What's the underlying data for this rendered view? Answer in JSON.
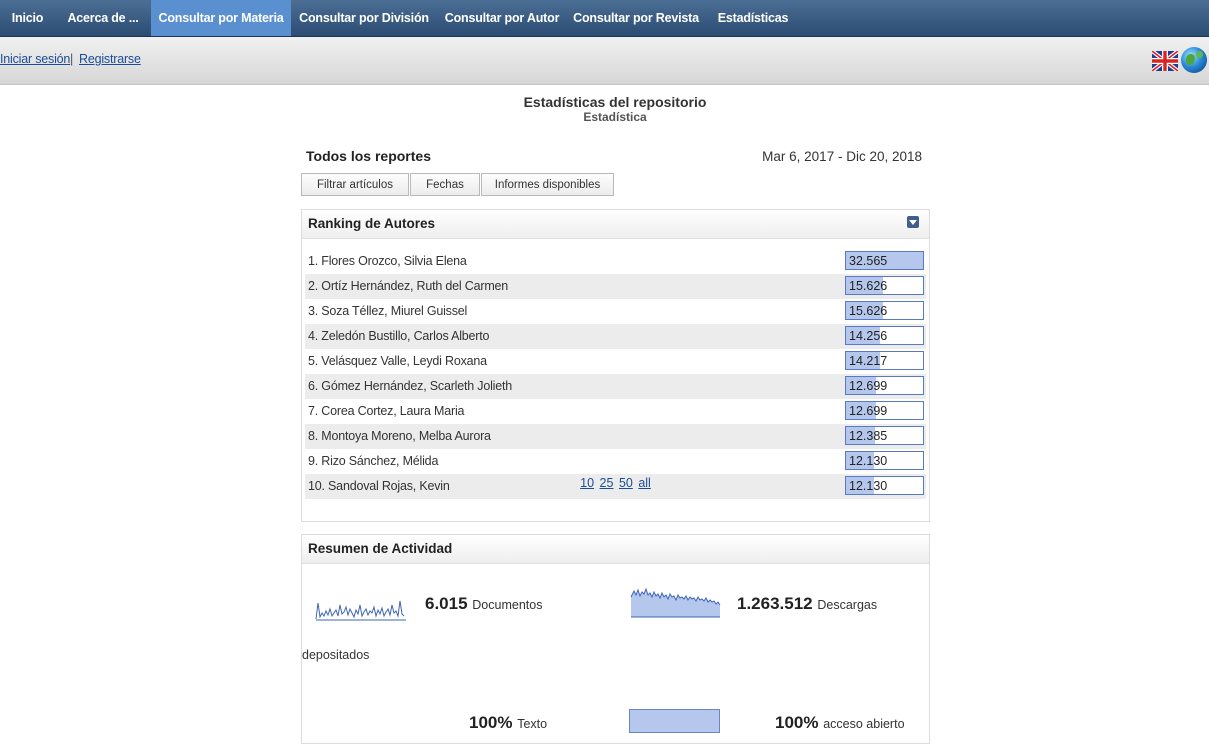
{
  "nav": {
    "items": [
      {
        "label": "Inicio"
      },
      {
        "label": "Acerca de ..."
      },
      {
        "label": "Consultar por Materia"
      },
      {
        "label": "Consultar por División"
      },
      {
        "label": "Consultar por Autor"
      },
      {
        "label": "Consultar por Revista"
      },
      {
        "label": "Estadísticas"
      }
    ],
    "active": "Consultar por Materia"
  },
  "login": {
    "login_label": "Iniciar sesión",
    "separator": "|",
    "register_label": "Registrarse"
  },
  "header": {
    "title": "Estadísticas del repositorio",
    "subtitle": "Estadística"
  },
  "reports": {
    "title": "Todos los reportes",
    "date_range": "Mar 6, 2017 - Dic 20, 2018",
    "buttons": [
      "Filtrar artículos",
      "Fechas",
      "Informes disponibles"
    ]
  },
  "ranking": {
    "title": "Ranking de Autores",
    "items": [
      {
        "label": "1. Flores Orozco, Silvia Elena",
        "value": "32.565",
        "fraction": 1.0
      },
      {
        "label": "2. Ortíz Hernández, Ruth del Carmen",
        "value": "15.626",
        "fraction": 0.48
      },
      {
        "label": "3. Soza Téllez, Miurel Guissel",
        "value": "15.626",
        "fraction": 0.48
      },
      {
        "label": "4. Zeledón Bustillo, Carlos Alberto",
        "value": "14.256",
        "fraction": 0.44
      },
      {
        "label": "5. Velásquez Valle, Leydi Roxana",
        "value": "14.217",
        "fraction": 0.44
      },
      {
        "label": "6. Gómez Hernández, Scarleth Jolieth",
        "value": "12.699",
        "fraction": 0.39
      },
      {
        "label": "7. Corea Cortez, Laura Maria",
        "value": "12.699",
        "fraction": 0.39
      },
      {
        "label": "8. Montoya Moreno, Melba Aurora",
        "value": "12.385",
        "fraction": 0.38
      },
      {
        "label": "9. Rizo Sánchez, Mélida",
        "value": "12.130",
        "fraction": 0.37
      },
      {
        "label": "10. Sandoval Rojas, Kevin",
        "value": "12.130",
        "fraction": 0.37
      }
    ],
    "pager": [
      "10",
      "25",
      "50",
      "all"
    ]
  },
  "activity": {
    "title": "Resumen de Actividad",
    "documents": {
      "value": "6.015",
      "label": "Documentos",
      "label_continued": "depositados"
    },
    "downloads": {
      "value": "1.263.512",
      "label": "Descargas"
    },
    "fulltext": {
      "value": "100%",
      "label": "Texto"
    },
    "openaccess": {
      "value": "100%",
      "label": "acceso abierto"
    }
  }
}
